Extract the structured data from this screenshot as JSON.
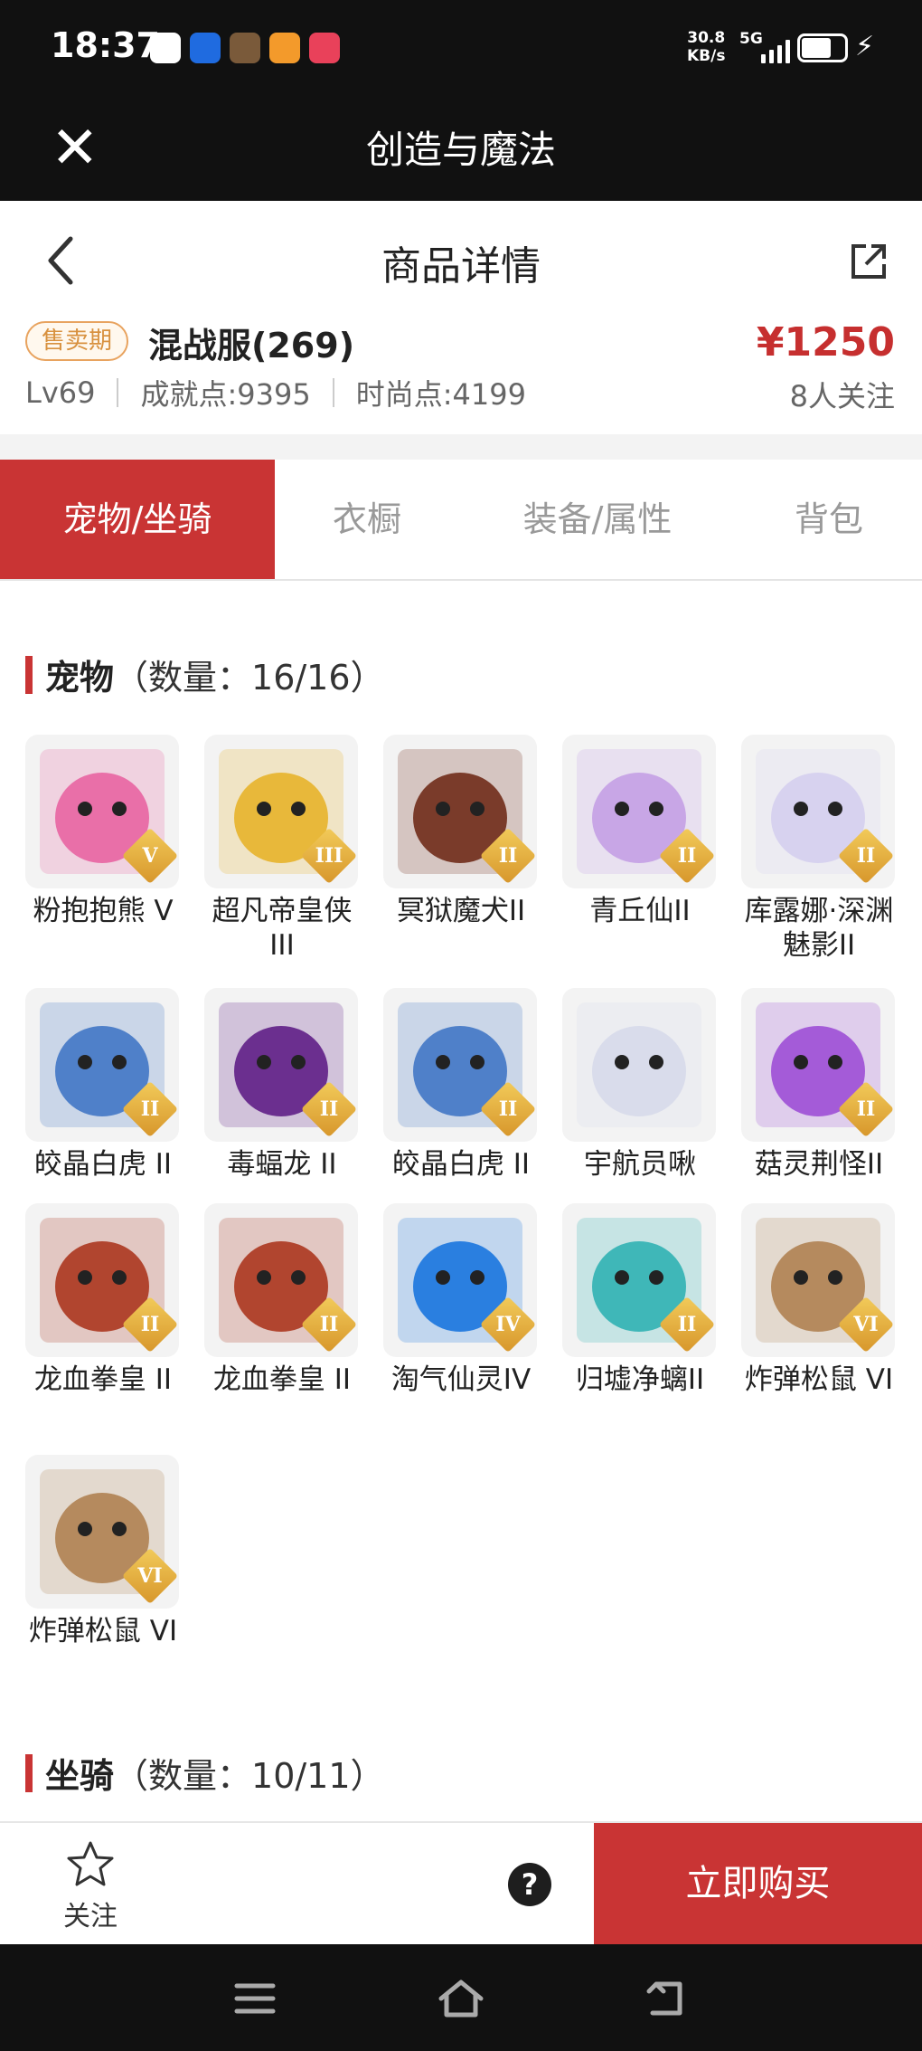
{
  "status_bar": {
    "time": "18:37",
    "net_speed": "30.8",
    "net_unit": "KB/s",
    "network": "5G",
    "battery_level": 0.7
  },
  "app_bar": {
    "title": "创造与魔法",
    "close_icon": "close-icon"
  },
  "page_header": {
    "title": "商品详情",
    "back_icon": "chevron-left-icon",
    "share_icon": "share-icon"
  },
  "summary": {
    "badge": "售卖期",
    "server": "混战服(269)",
    "price": "¥1250",
    "level": "Lv69",
    "achievement": "成就点:9395",
    "fashion": "时尚点:4199",
    "watchers": "8人关注"
  },
  "tabs": [
    {
      "label": "宠物/坐骑",
      "active": true
    },
    {
      "label": "衣橱",
      "active": false
    },
    {
      "label": "装备/属性",
      "active": false
    },
    {
      "label": "背包",
      "active": false
    }
  ],
  "pets_section": {
    "title": "宠物",
    "count": "（数量：16/16）"
  },
  "pets": [
    {
      "name": "粉抱抱熊 V",
      "rank": "V",
      "color": "#e96fa8"
    },
    {
      "name": "超凡帝皇侠 III",
      "rank": "III",
      "color": "#e8b83a"
    },
    {
      "name": "冥狱魔犬II",
      "rank": "II",
      "color": "#7a3b2a"
    },
    {
      "name": "青丘仙II",
      "rank": "II",
      "color": "#c8a6e6"
    },
    {
      "name": "库露娜·深渊魅影II",
      "rank": "II",
      "color": "#d7d2ef"
    },
    {
      "name": "皎晶白虎 II",
      "rank": "II",
      "color": "#4f80c9"
    },
    {
      "name": "毒蝠龙 II",
      "rank": "II",
      "color": "#6b2f8f"
    },
    {
      "name": "皎晶白虎 II",
      "rank": "II",
      "color": "#4f80c9"
    },
    {
      "name": "宇航员啾",
      "rank": "",
      "color": "#d9dceb"
    },
    {
      "name": "菇灵荆怪II",
      "rank": "II",
      "color": "#a45bd8"
    },
    {
      "name": "龙血拳皇 II",
      "rank": "II",
      "color": "#b1452f"
    },
    {
      "name": "龙血拳皇 II",
      "rank": "II",
      "color": "#b1452f"
    },
    {
      "name": "淘气仙灵IV",
      "rank": "IV",
      "color": "#2a7fe0"
    },
    {
      "name": "归墟净螭II",
      "rank": "II",
      "color": "#3fb7b8"
    },
    {
      "name": "炸弹松鼠 VI",
      "rank": "VI",
      "color": "#b58a5e"
    },
    {
      "name": "炸弹松鼠 VI",
      "rank": "VI",
      "color": "#b58a5e"
    }
  ],
  "mounts_section": {
    "title": "坐骑",
    "count": "（数量：10/11）"
  },
  "bottom_bar": {
    "favorite_label": "关注",
    "help_icon": "help-icon",
    "buy_label": "立即购买"
  },
  "nav_bar": {
    "icons": [
      "menu-icon",
      "home-icon",
      "back-icon"
    ]
  }
}
